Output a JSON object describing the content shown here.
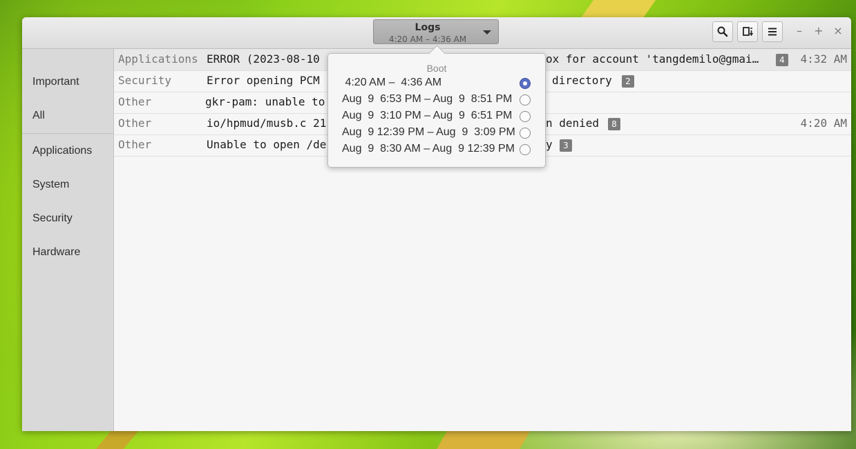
{
  "window": {
    "title": "Logs",
    "subtitle": "4:20 AM – 4:36 AM"
  },
  "sidebar": {
    "items": [
      {
        "label": "Important"
      },
      {
        "label": "All"
      },
      {
        "label": "Applications"
      },
      {
        "label": "System"
      },
      {
        "label": "Security"
      },
      {
        "label": "Hardware"
      }
    ]
  },
  "logs": {
    "rows": [
      {
        "category": "Applications",
        "message": "ERROR (2023-08-10",
        "message_tail": "ox for account 'tangdemilo@gmai…",
        "count": "4",
        "time": "4:32 AM"
      },
      {
        "category": "Security",
        "message": "Error opening PCM",
        "message_tail": "directory",
        "count": "2",
        "time": ""
      },
      {
        "category": "Other",
        "message": "gkr-pam: unable to",
        "message_tail": "",
        "count": "",
        "time": ""
      },
      {
        "category": "Other",
        "message": "io/hpmud/musb.c 21",
        "message_tail": "n denied",
        "count": "8",
        "time": "4:20 AM"
      },
      {
        "category": "Other",
        "message": "Unable to open /de",
        "message_tail": "y",
        "count": "3",
        "time": ""
      }
    ]
  },
  "boot_popover": {
    "title": "Boot",
    "items": [
      {
        "label": " 4:20 AM –  4:36 AM",
        "selected": true
      },
      {
        "label": "Aug  9  6:53 PM – Aug  9  8:51 PM",
        "selected": false
      },
      {
        "label": "Aug  9  3:10 PM – Aug  9  6:51 PM",
        "selected": false
      },
      {
        "label": "Aug  9 12:39 PM – Aug  9  3:09 PM",
        "selected": false
      },
      {
        "label": "Aug  9  8:30 AM – Aug  9 12:39 PM",
        "selected": false
      }
    ]
  },
  "colors": {
    "accent": "#5a6fc4",
    "badge": "#7b7b7b",
    "sidebar_bg": "#d9d9d9"
  },
  "icons": {
    "search": "search-icon",
    "export": "export-icon",
    "menu": "hamburger-menu-icon",
    "minimize": "minimize-icon",
    "maximize": "maximize-icon",
    "close": "close-icon"
  }
}
